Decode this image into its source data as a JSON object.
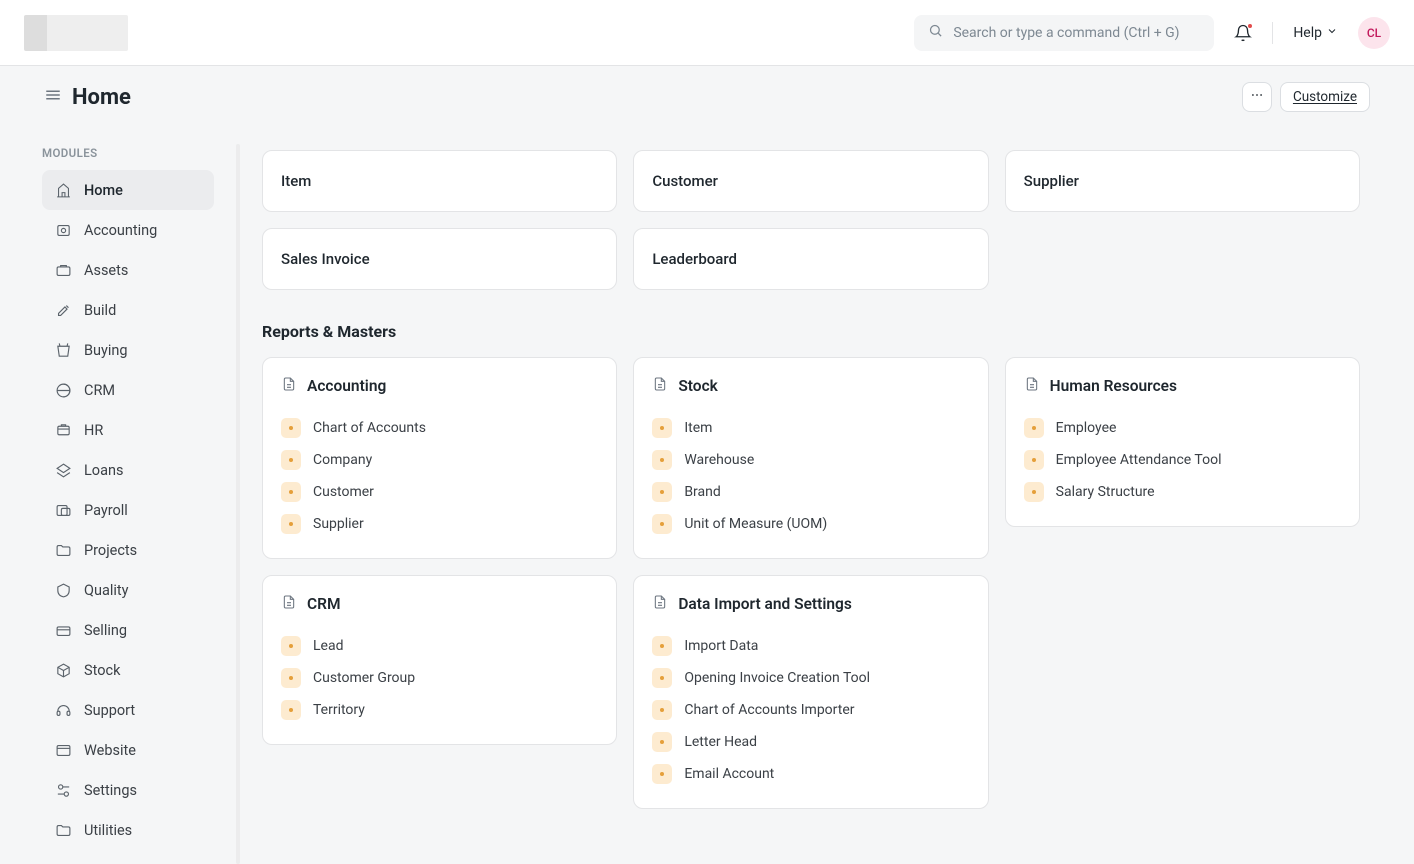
{
  "header": {
    "search_placeholder": "Search or type a command (Ctrl + G)",
    "help_label": "Help",
    "avatar_initials": "CL"
  },
  "page": {
    "title": "Home",
    "customize_label": "Customize"
  },
  "sidebar": {
    "heading": "MODULES",
    "items": [
      {
        "label": "Home",
        "active": true
      },
      {
        "label": "Accounting"
      },
      {
        "label": "Assets"
      },
      {
        "label": "Build"
      },
      {
        "label": "Buying"
      },
      {
        "label": "CRM"
      },
      {
        "label": "HR"
      },
      {
        "label": "Loans"
      },
      {
        "label": "Payroll"
      },
      {
        "label": "Projects"
      },
      {
        "label": "Quality"
      },
      {
        "label": "Selling"
      },
      {
        "label": "Stock"
      },
      {
        "label": "Support"
      },
      {
        "label": "Website"
      },
      {
        "label": "Settings"
      },
      {
        "label": "Utilities"
      }
    ]
  },
  "quick_links": [
    "Item",
    "Customer",
    "Supplier",
    "Sales Invoice",
    "Leaderboard"
  ],
  "reports": {
    "section_title": "Reports & Masters",
    "cards": [
      {
        "title": "Accounting",
        "items": [
          "Chart of Accounts",
          "Company",
          "Customer",
          "Supplier"
        ]
      },
      {
        "title": "Stock",
        "items": [
          "Item",
          "Warehouse",
          "Brand",
          "Unit of Measure (UOM)"
        ]
      },
      {
        "title": "Human Resources",
        "items": [
          "Employee",
          "Employee Attendance Tool",
          "Salary Structure"
        ]
      },
      {
        "title": "CRM",
        "items": [
          "Lead",
          "Customer Group",
          "Territory"
        ]
      },
      {
        "title": "Data Import and Settings",
        "items": [
          "Import Data",
          "Opening Invoice Creation Tool",
          "Chart of Accounts Importer",
          "Letter Head",
          "Email Account"
        ]
      }
    ]
  }
}
